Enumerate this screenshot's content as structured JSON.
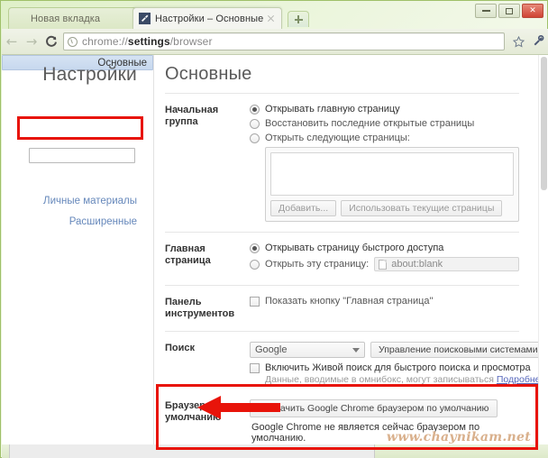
{
  "window": {
    "controls": {
      "minimize_label": "Minimize",
      "maximize_label": "Maximize",
      "close_label": "✕"
    }
  },
  "tabs": [
    {
      "title": "Новая вкладка",
      "active": false
    },
    {
      "title": "Настройки – Основные",
      "active": true
    }
  ],
  "newtab": {
    "label": "+"
  },
  "toolbar": {
    "back_label": "←",
    "forward_label": "→",
    "reload_label": "C",
    "url_prefix": "chrome://",
    "url_bold": "settings",
    "url_suffix": "/browser",
    "bookmark_label": "☆",
    "menu_label": "wrench"
  },
  "sidebar": {
    "title": "Настройки",
    "search_placeholder": "",
    "search_value": "",
    "items": [
      {
        "label": "Основные",
        "selected": true
      },
      {
        "label": "Личные материалы",
        "selected": false
      },
      {
        "label": "Расширенные",
        "selected": false
      }
    ]
  },
  "main": {
    "title": "Основные",
    "sections": {
      "startup": {
        "label": "Начальная группа",
        "options": [
          {
            "label": "Открывать главную страницу",
            "checked": true
          },
          {
            "label": "Восстановить последние открытые страницы",
            "checked": false
          },
          {
            "label": "Открыть следующие страницы:",
            "checked": false
          }
        ],
        "textarea_value": "",
        "add_button": "Добавить...",
        "use_current_button": "Использовать текущие страницы"
      },
      "homepage": {
        "label": "Главная страница",
        "option_newtab": {
          "label": "Открывать страницу быстрого доступа",
          "checked": true
        },
        "option_custom": {
          "label": "Открыть эту страницу:",
          "checked": false
        },
        "url_value": "about:blank"
      },
      "toolbar": {
        "label_line1": "Панель",
        "label_line2": "инструментов",
        "show_home_button": {
          "label": "Показать кнопку \"Главная страница\"",
          "checked": false
        }
      },
      "search": {
        "label": "Поиск",
        "engine_selected": "Google",
        "manage_button": "Управление поисковыми системами...",
        "instant": {
          "label": "Включить Живой поиск для быстрого поиска и просмотра",
          "checked": false
        },
        "note_text": "Данные, вводимые в омнибокс, могут записываться",
        "note_link": "Подробнее..."
      },
      "default_browser": {
        "label_line1": "Браузер по",
        "label_line2": "умолчанию",
        "button": "Назначить Google Chrome браузером по умолчанию",
        "status": "Google Chrome не является сейчас браузером по умолчанию."
      }
    }
  },
  "annotations": {
    "watermark": "www.chaynikam.net",
    "highlight_color": "#e8140a"
  }
}
